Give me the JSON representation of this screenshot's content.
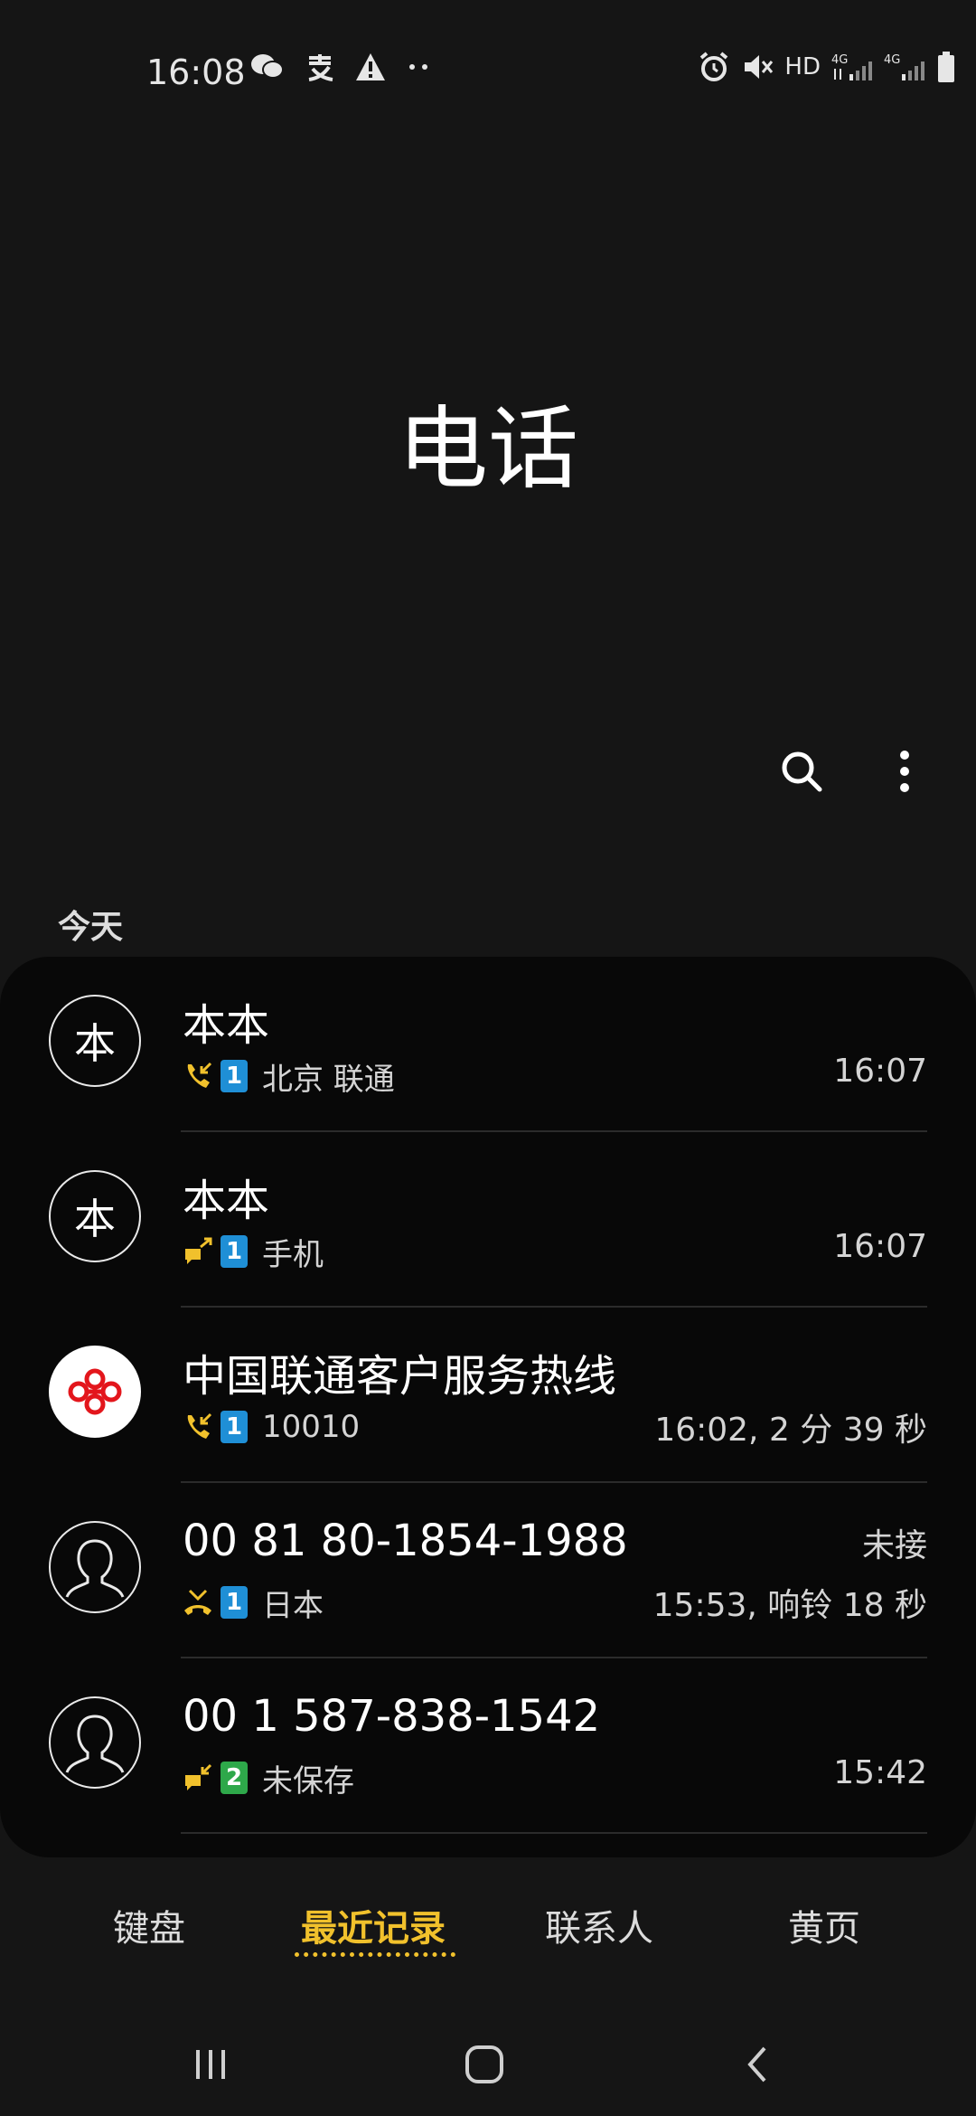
{
  "status_bar": {
    "time": "16:08",
    "left_icons": [
      "wechat-icon",
      "alipay-icon",
      "warning-icon",
      "more-dots-icon"
    ],
    "right_icons": [
      "alarm-icon",
      "mute-icon",
      "hd-label",
      "4g-signal-icon",
      "4g-signal-icon",
      "battery-icon"
    ],
    "hd_text": "HD"
  },
  "header": {
    "title": "电话"
  },
  "actions": {
    "search_icon": "search-icon",
    "more_icon": "more-vertical-icon"
  },
  "section": {
    "label": "今天"
  },
  "calls": [
    {
      "avatar_text": "本",
      "name": "本本",
      "call_type": "incoming",
      "sim": "1",
      "detail": "北京 联通",
      "time": "16:07",
      "status": ""
    },
    {
      "avatar_text": "本",
      "name": "本本",
      "call_type": "outgoing-message",
      "sim": "1",
      "detail": "手机",
      "time": "16:07",
      "status": ""
    },
    {
      "avatar_text": "",
      "name": "中国联通客户服务热线",
      "call_type": "incoming",
      "sim": "1",
      "detail": "10010",
      "time": "16:02, 2 分 39 秒",
      "status": ""
    },
    {
      "avatar_text": "",
      "name": "00 81 80-1854-1988",
      "call_type": "missed",
      "sim": "1",
      "detail": "日本",
      "time": "15:53, 响铃 18 秒",
      "status": "未接"
    },
    {
      "avatar_text": "",
      "name": "00 1 587-838-1542",
      "call_type": "incoming-message",
      "sim": "2",
      "detail": "未保存",
      "time": "15:42",
      "status": ""
    }
  ],
  "tabs": [
    {
      "label": "键盘",
      "active": false
    },
    {
      "label": "最近记录",
      "active": true
    },
    {
      "label": "联系人",
      "active": false
    },
    {
      "label": "黄页",
      "active": false
    }
  ],
  "colors": {
    "accent": "#f1c12c",
    "sim1": "#1f8fd6",
    "sim2": "#2ea84a",
    "background": "#151515",
    "card": "#080808"
  }
}
